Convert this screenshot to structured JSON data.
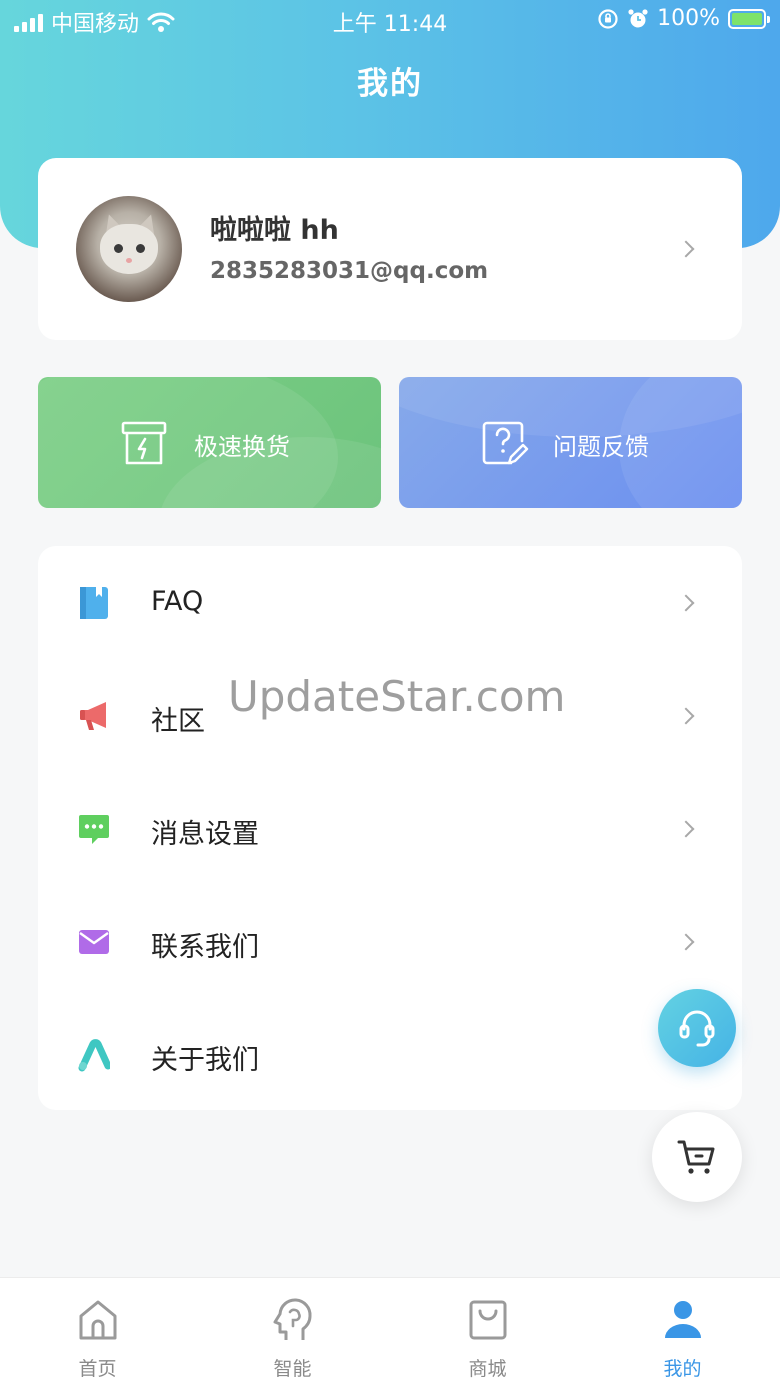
{
  "status_bar": {
    "carrier": "中国移动",
    "time": "上午 11:44",
    "battery": "100%"
  },
  "header": {
    "title": "我的"
  },
  "profile": {
    "name": "啦啦啦 hh",
    "email": "2835283031@qq.com"
  },
  "actions": [
    {
      "label": "极速换货",
      "icon": "exchange-box-icon",
      "color": "#74c983"
    },
    {
      "label": "问题反馈",
      "icon": "feedback-question-icon",
      "color": "#7a9cec"
    }
  ],
  "menu": [
    {
      "label": "FAQ",
      "icon": "notebook-icon",
      "color": "#4fb0ec"
    },
    {
      "label": "社区",
      "icon": "megaphone-icon",
      "color": "#ec6a6a"
    },
    {
      "label": "消息设置",
      "icon": "chat-bubble-icon",
      "color": "#5fcf5f"
    },
    {
      "label": "联系我们",
      "icon": "envelope-icon",
      "color": "#b06be8"
    },
    {
      "label": "关于我们",
      "icon": "logo-a-icon",
      "color": "#3fc7c2"
    }
  ],
  "watermark": "UpdateStar.com",
  "tab_bar": {
    "tabs": [
      {
        "label": "首页",
        "icon": "home-icon",
        "active": false
      },
      {
        "label": "智能",
        "icon": "head-brain-icon",
        "active": false
      },
      {
        "label": "商城",
        "icon": "shopping-bag-icon",
        "active": false
      },
      {
        "label": "我的",
        "icon": "user-icon",
        "active": true
      }
    ]
  },
  "colors": {
    "header_gradient_start": "#66d6dc",
    "header_gradient_end": "#4ea8ec",
    "active_tab": "#3a96e6"
  }
}
